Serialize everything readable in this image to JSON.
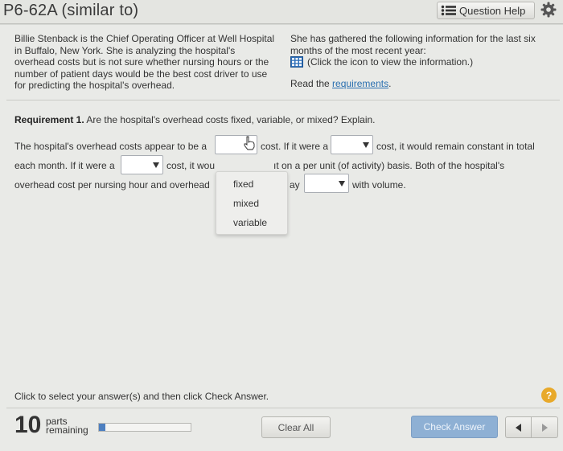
{
  "header": {
    "title": "P6-62A (similar to)",
    "question_help": "Question Help",
    "list_icon": "list-icon",
    "gear_icon": "gear-icon"
  },
  "intro": {
    "left_lines": [
      "Billie Stenback is the Chief Operating Officer at Well Hospital",
      "in Buffalo, New York. She is analyzing the hospital's",
      "overhead costs but is not sure whether nursing hours or the",
      "number of patient days would be the best cost driver to use",
      "for predicting the hospital's overhead."
    ],
    "right_line1": "She has gathered the following information for the last six",
    "right_line2": "months of the most recent year:",
    "info_link": "(Click the icon to view the information.)",
    "read_prefix": "Read the ",
    "requirements_link": "requirements",
    "read_suffix": "."
  },
  "requirement": {
    "label": "Requirement 1.",
    "question": " Are the hospital's overhead costs fixed, variable, or mixed? Explain."
  },
  "answer": {
    "s1": "The hospital's overhead costs appear to be a",
    "s2": "cost. If it were a",
    "s3": "cost, it would remain constant in total",
    "s4": "each month. If it were a",
    "s5": "cost, it wou",
    "s6": "ıt on a per unit (of activity) basis. Both of the hospital's",
    "s7": "overhead cost per nursing hour and overhead",
    "s8": "ay",
    "s9": "with volume."
  },
  "dropdown_options": [
    "fixed",
    "mixed",
    "variable"
  ],
  "footer": {
    "hint": "Click to select your answer(s) and then click Check Answer.",
    "help_symbol": "?",
    "parts_count": "10",
    "parts_label_1": "parts",
    "parts_label_2": "remaining",
    "progress_fraction": 0.07,
    "clear_all": "Clear All",
    "check_answer": "Check Answer"
  },
  "colors": {
    "link": "#2a6fb0",
    "progress_fill": "#4d7fc0",
    "check_button": "#8eb0d4",
    "help_circle": "#e8a92a"
  }
}
